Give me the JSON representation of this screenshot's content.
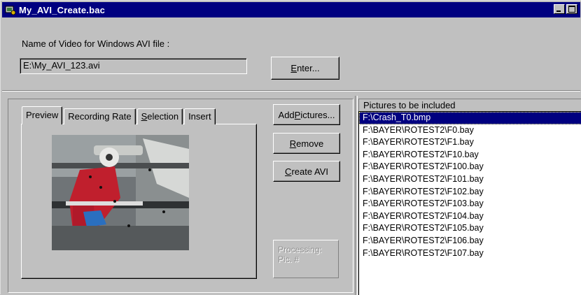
{
  "window": {
    "title": "My_AVI_Create.bac"
  },
  "file_section": {
    "label": "Name of Video for Windows AVI file :",
    "value": "E:\\My_AVI_123.avi",
    "enter_prefix": "",
    "enter_accel": "E",
    "enter_rest": "nter..."
  },
  "tabs": [
    {
      "pre": "",
      "accel": "",
      "rest": "Preview"
    },
    {
      "pre": "",
      "accel": "",
      "rest": "Recording Rate"
    },
    {
      "pre": "",
      "accel": "S",
      "rest": "election"
    },
    {
      "pre": "",
      "accel": "",
      "rest": "Insert"
    }
  ],
  "buttons": {
    "add_pre": "Add ",
    "add_accel": "P",
    "add_rest": "ictures...",
    "remove_accel": "R",
    "remove_rest": "emove",
    "create_accel": "C",
    "create_rest": "reate AVI"
  },
  "processing": {
    "line1": "Processing:",
    "line2": "Pic. #"
  },
  "list": {
    "header": "Pictures to be included",
    "items": [
      "F:\\Crash_T0.bmp",
      "F:\\BAYER\\ROTEST2\\F0.bay",
      "F:\\BAYER\\ROTEST2\\F1.bay",
      "F:\\BAYER\\ROTEST2\\F10.bay",
      "F:\\BAYER\\ROTEST2\\F100.bay",
      "F:\\BAYER\\ROTEST2\\F101.bay",
      "F:\\BAYER\\ROTEST2\\F102.bay",
      "F:\\BAYER\\ROTEST2\\F103.bay",
      "F:\\BAYER\\ROTEST2\\F104.bay",
      "F:\\BAYER\\ROTEST2\\F105.bay",
      "F:\\BAYER\\ROTEST2\\F106.bay",
      "F:\\BAYER\\ROTEST2\\F107.bay"
    ],
    "selected_index": 0
  },
  "icons": {
    "app": "avi-app-icon",
    "minimize": "minimize-icon",
    "maximize": "maximize-icon"
  },
  "colors": {
    "titlebar": "#000080",
    "face": "#c0c0c0",
    "selection": "#000080"
  }
}
